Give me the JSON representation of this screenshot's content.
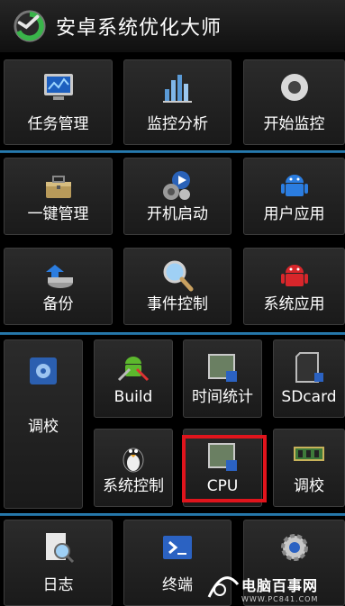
{
  "app": {
    "title": "安卓系统优化大师"
  },
  "row1": [
    "任务管理",
    "监控分析",
    "开始监控"
  ],
  "row2": [
    "一键管理",
    "开机启动",
    "用户应用"
  ],
  "row3": [
    "备份",
    "事件控制",
    "系统应用"
  ],
  "tuning": {
    "big": "调校",
    "top": [
      "Build",
      "时间统计",
      "SDcard"
    ],
    "bottom": [
      "系统控制",
      "CPU",
      "调校"
    ]
  },
  "row5": [
    "日志",
    "终端",
    ""
  ],
  "watermark": {
    "main": "电脑百事网",
    "sub": "WWW.PC841.COM"
  },
  "colors": {
    "accent": "#2f8fc8",
    "highlight": "#e0141c"
  }
}
